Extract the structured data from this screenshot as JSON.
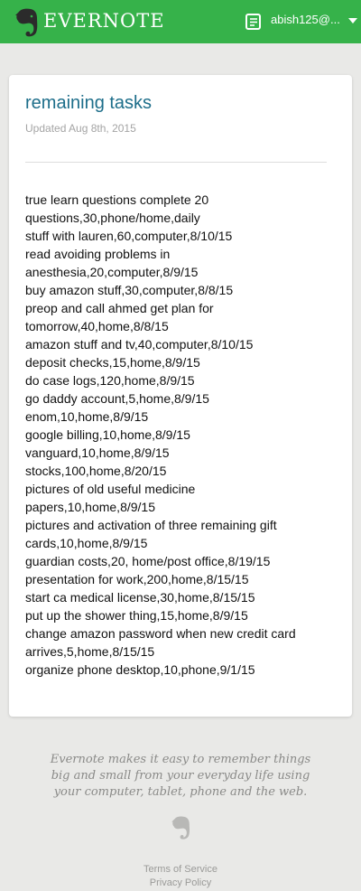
{
  "header": {
    "brand": "EVERNOTE",
    "account_name": "abish125@...",
    "colors": {
      "bar": "#36b24a",
      "text": "#ffffff"
    }
  },
  "note": {
    "title": "remaining tasks",
    "updated": "Updated Aug 8th, 2015",
    "lines": [
      "true learn questions complete 20",
      "questions,30,phone/home,daily",
      "stuff with lauren,60,computer,8/10/15",
      "read avoiding problems in",
      "anesthesia,20,computer,8/9/15",
      "buy amazon stuff,30,computer,8/8/15",
      "preop and call ahmed get plan for",
      "tomorrow,40,home,8/8/15",
      "amazon stuff and tv,40,computer,8/10/15",
      "deposit checks,15,home,8/9/15",
      "do case logs,120,home,8/9/15",
      "go daddy account,5,home,8/9/15",
      "enom,10,home,8/9/15",
      "google billing,10,home,8/9/15",
      "vanguard,10,home,8/9/15",
      "stocks,100,home,8/20/15",
      "pictures of old useful medicine",
      "papers,10,home,8/9/15",
      "pictures and activation of three remaining gift",
      "cards,10,home,8/9/15",
      "guardian costs,20, home/post office,8/19/15",
      "presentation for work,200,home,8/15/15",
      "start ca medical license,30,home,8/15/15",
      "put up the shower thing,15,home,8/9/15",
      "change amazon password when new credit card",
      "arrives,5,home,8/15/15",
      "organize phone desktop,10,phone,9/1/15"
    ],
    "colors": {
      "title": "#1d6e8a"
    }
  },
  "footer": {
    "blurb": "Evernote makes it easy to remember things big and small from your everyday life using your computer, tablet, phone and the web.",
    "terms_label": "Terms of Service",
    "privacy_label": "Privacy Policy"
  },
  "icons": {
    "logo": "evernote-elephant-icon",
    "notebook": "notebook-icon",
    "caret": "caret-down-icon",
    "footer_logo": "evernote-elephant-icon"
  }
}
